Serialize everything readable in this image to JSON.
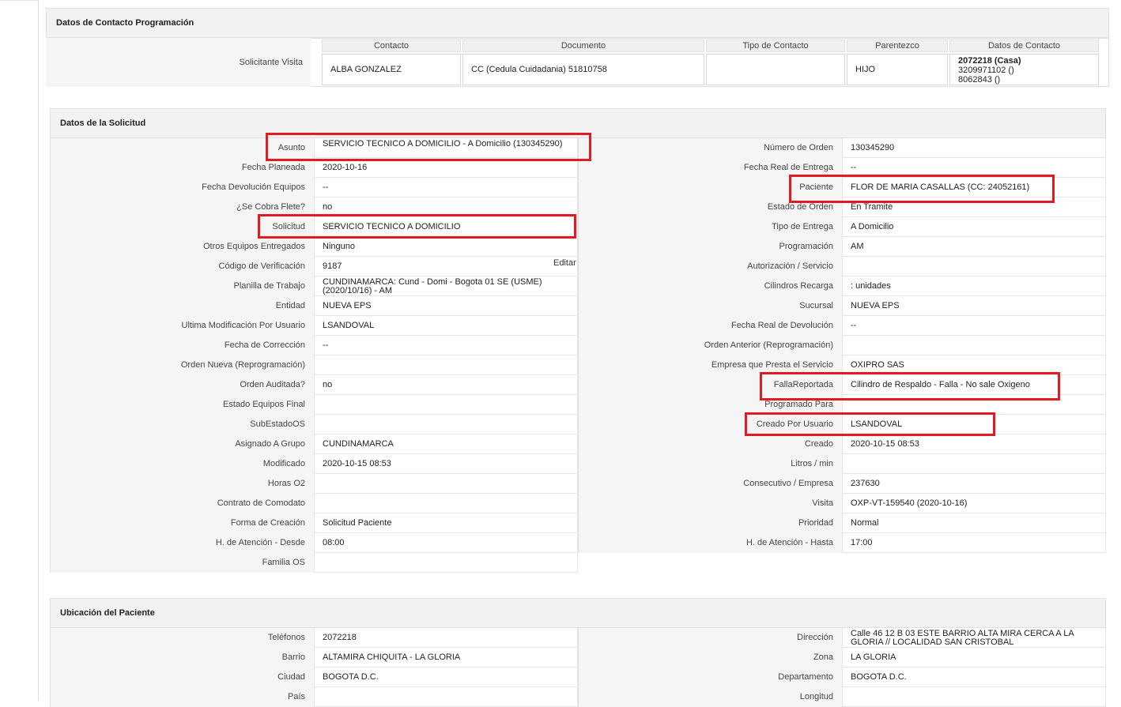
{
  "contacto": {
    "title": "Datos de Contacto Programación",
    "row_label": "Solicitante Visita",
    "headers": [
      "Contacto",
      "Documento",
      "Tipo de Contacto",
      "Parentezco",
      "Datos de Contacto"
    ],
    "contacto": "ALBA GONZALEZ",
    "documento": "CC (Cedula Cuidadania) 51810758",
    "tipo": "",
    "parentezco": "HIJO",
    "datos": [
      "2072218 (Casa)",
      "3209971102 ()",
      "8062843 ()"
    ]
  },
  "solicitud": {
    "title": "Datos de la Solicitud",
    "edit_label": "Editar",
    "left": [
      {
        "label": "Asunto",
        "value": "SERVICIO TECNICO A DOMICILIO - A Domicilio (130345290)"
      },
      {
        "label": "Fecha Planeada",
        "value": "2020-10-16"
      },
      {
        "label": "Fecha Devolución Equipos",
        "value": "--"
      },
      {
        "label": "¿Se Cobra Flete?",
        "value": "no"
      },
      {
        "label": "Solicitud",
        "value": "SERVICIO TECNICO A DOMICILIO"
      },
      {
        "label": "Otros Equipos Entregados",
        "value": "Ninguno"
      },
      {
        "label": "Código de Verificación",
        "value": "9187"
      },
      {
        "label": "Planilla de Trabajo",
        "value": "CUNDINAMARCA: Cund - Domi - Bogota 01 SE (USME) (2020/10/16) - AM"
      },
      {
        "label": "Entidad",
        "value": "NUEVA EPS"
      },
      {
        "label": "Ultima Modificación Por Usuario",
        "value": "LSANDOVAL"
      },
      {
        "label": "Fecha de Corrección",
        "value": "--"
      },
      {
        "label": "Orden Nueva (Reprogramación)",
        "value": ""
      },
      {
        "label": "Orden Auditada?",
        "value": "no"
      },
      {
        "label": "Estado Equipos Final",
        "value": ""
      },
      {
        "label": "SubEstadoOS",
        "value": ""
      },
      {
        "label": "Asignado A Grupo",
        "value": "CUNDINAMARCA"
      },
      {
        "label": "Modificado",
        "value": "2020-10-15 08:53"
      },
      {
        "label": "Horas O2",
        "value": ""
      },
      {
        "label": "Contrato de Comodato",
        "value": ""
      },
      {
        "label": "Forma de Creación",
        "value": "Solicitud Paciente"
      },
      {
        "label": "H. de Atención - Desde",
        "value": "08:00"
      },
      {
        "label": "Familia OS",
        "value": ""
      }
    ],
    "right": [
      {
        "label": "Número de Orden",
        "value": "130345290"
      },
      {
        "label": "Fecha Real de Entrega",
        "value": "--"
      },
      {
        "label": "Paciente",
        "value": "FLOR DE MARIA CASALLAS (CC: 24052161)"
      },
      {
        "label": "Estado de Orden",
        "value": "En Tramite"
      },
      {
        "label": "Tipo de Entrega",
        "value": "A Domicilio"
      },
      {
        "label": "Programación",
        "value": "AM"
      },
      {
        "label": "Autorización / Servicio",
        "value": ""
      },
      {
        "label": "Cilindros Recarga",
        "value": ": unidades"
      },
      {
        "label": "Sucursal",
        "value": "NUEVA EPS"
      },
      {
        "label": "Fecha Real de Devolución",
        "value": "--"
      },
      {
        "label": "Orden Anterior (Reprogramación)",
        "value": ""
      },
      {
        "label": "Empresa que Presta el Servicio",
        "value": "OXIPRO SAS"
      },
      {
        "label": "FallaReportada",
        "value": "Cilindro de Respaldo - Falla - No sale Oxigeno"
      },
      {
        "label": "Programado Para",
        "value": ""
      },
      {
        "label": "Creado Por Usuario",
        "value": "LSANDOVAL"
      },
      {
        "label": "Creado",
        "value": "2020-10-15 08:53"
      },
      {
        "label": "Litros / min",
        "value": ""
      },
      {
        "label": "Consecutivo / Empresa",
        "value": "237630"
      },
      {
        "label": "Visita",
        "value": "OXP-VT-159540 (2020-10-16)"
      },
      {
        "label": "Prioridad",
        "value": "Normal"
      },
      {
        "label": "H. de Atención - Hasta",
        "value": "17:00"
      }
    ]
  },
  "ubicacion": {
    "title": "Ubicación del Paciente",
    "left": [
      {
        "label": "Teléfonos",
        "value": "2072218"
      },
      {
        "label": "Barrio",
        "value": "ALTAMIRA CHIQUITA - LA GLORIA"
      },
      {
        "label": "Ciudad",
        "value": "BOGOTA D.C."
      },
      {
        "label": "País",
        "value": ""
      }
    ],
    "right": [
      {
        "label": "Dirección",
        "value": "Calle 46 12 B 03 ESTE BARRIO ALTA MIRA CERCA A LA GLORIA // LOCALIDAD SAN CRISTOBAL"
      },
      {
        "label": "Zona",
        "value": "LA GLORIA"
      },
      {
        "label": "Departamento",
        "value": "BOGOTA D.C."
      },
      {
        "label": "Longitud",
        "value": ""
      }
    ]
  },
  "highlight_color": "#e01b24"
}
